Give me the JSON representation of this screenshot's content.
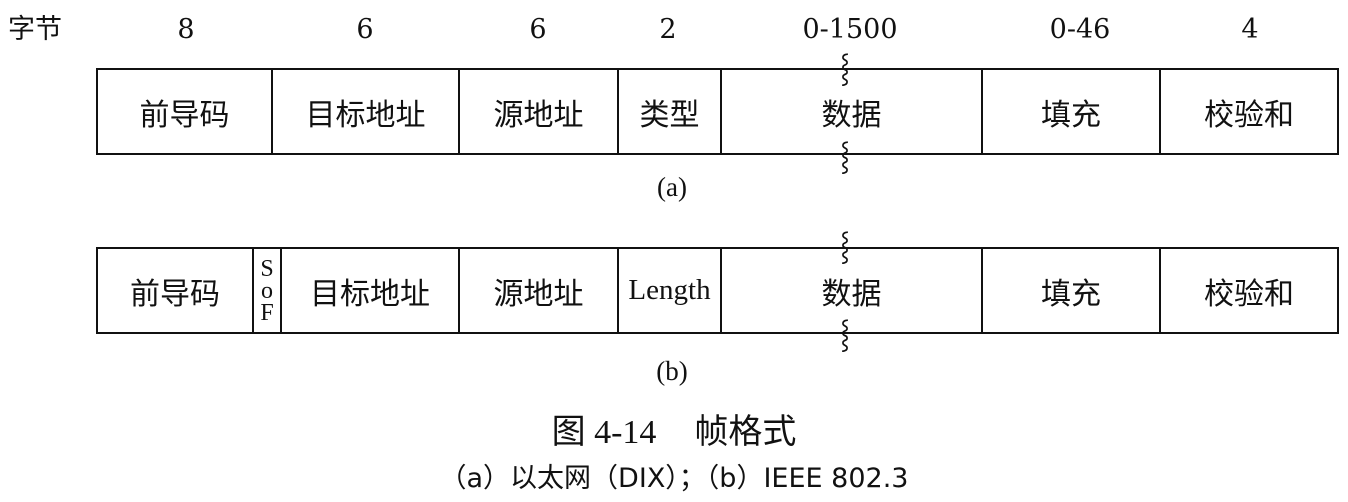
{
  "header": {
    "bytes_label": "字节",
    "sizes": [
      "8",
      "6",
      "6",
      "2",
      "0-1500",
      "0-46",
      "4"
    ]
  },
  "frame_a": {
    "fields": [
      "前导码",
      "目标地址",
      "源地址",
      "类型",
      "数据",
      "填充",
      "校验和"
    ],
    "label": "(a)"
  },
  "frame_b": {
    "fields": [
      "前导码",
      "目标地址",
      "源地址",
      "Length",
      "数据",
      "填充",
      "校验和"
    ],
    "sof": [
      "S",
      "o",
      "F"
    ],
    "label": "(b)"
  },
  "break_mark": "⸾",
  "figure": {
    "number": "图 4-14",
    "title": "帧格式",
    "caption": "（a）以太网（DIX）；（b）IEEE 802.3"
  }
}
